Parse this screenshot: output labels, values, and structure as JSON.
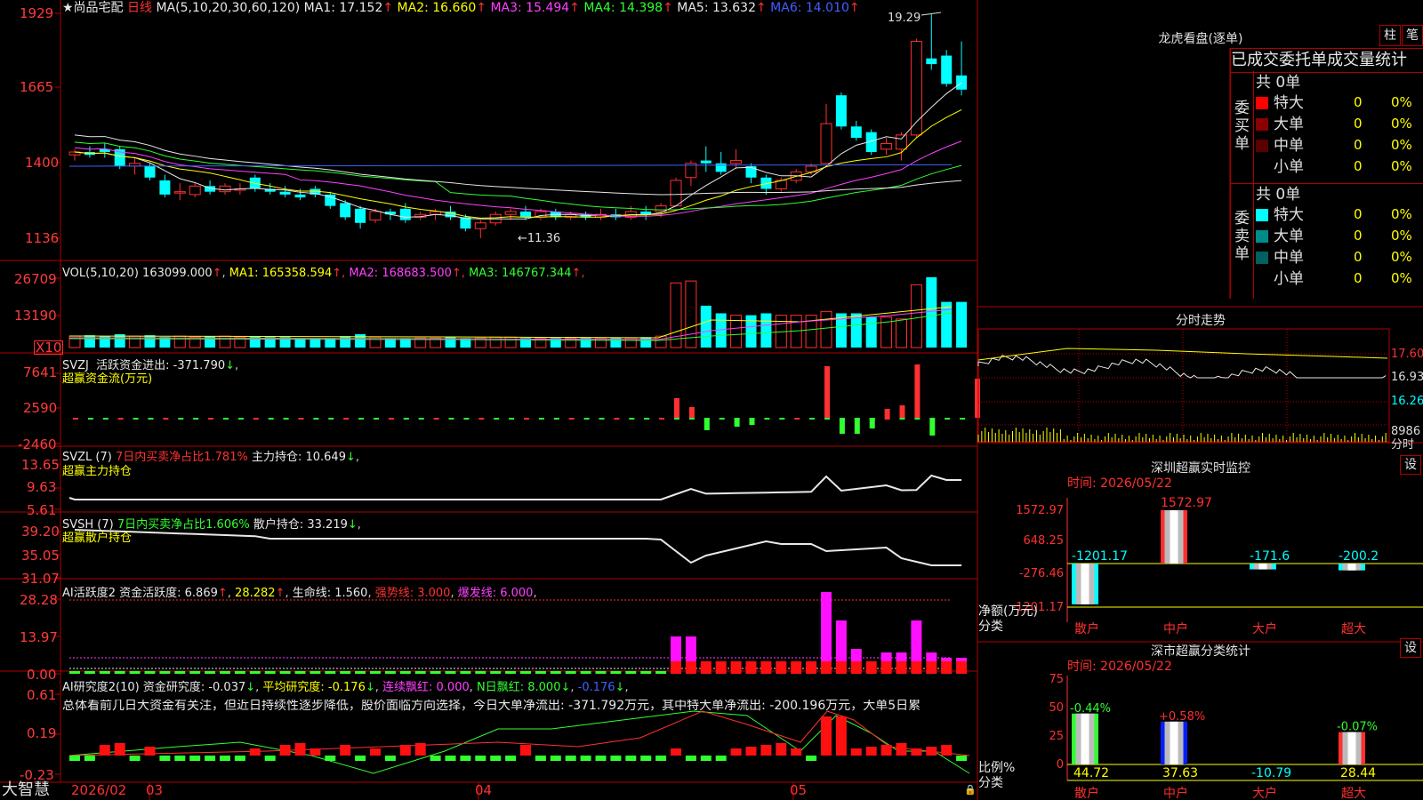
{
  "app": {
    "logo": "大智慧",
    "stock_name": "★尚品宅配",
    "period": "日线"
  },
  "colors": {
    "up": "#ff3030",
    "down": "#00ffff",
    "grid": "#b00000",
    "text_red": "#ff3b3b"
  },
  "main_chart": {
    "ma_params": "MA(5,10,20,30,60,120)",
    "ma_values": [
      {
        "label": "MA1: 17.152",
        "color": "#e8e8e8"
      },
      {
        "label": "MA2: 16.660",
        "color": "#ffff00"
      },
      {
        "label": "MA3: 15.494",
        "color": "#ff40ff"
      },
      {
        "label": "MA4: 14.398",
        "color": "#30ff30"
      },
      {
        "label": "MA5: 13.632",
        "color": "#e8e8e8"
      },
      {
        "label": "MA6: 14.010",
        "color": "#4060ff"
      }
    ],
    "y_ticks": [
      "1929",
      "1665",
      "1400",
      "1136"
    ],
    "high_label": "19.29",
    "low_label": "←11.36"
  },
  "volume_panel": {
    "title": "VOL(5,10,20)",
    "value": "163099.000",
    "mas": [
      {
        "label": "MA1: 165358.594",
        "color": "#ffff00"
      },
      {
        "label": "MA2: 168683.500",
        "color": "#ff40ff"
      },
      {
        "label": "MA3: 146767.344",
        "color": "#30ff30"
      }
    ],
    "y_ticks": [
      "26709",
      "13190"
    ],
    "unit": "X10"
  },
  "svzj_panel": {
    "title": "SVZJ",
    "label": "活跃资金进出: -371.790",
    "subtitle": "超赢资金流(万元)",
    "y_ticks": [
      "7641",
      "2590",
      "-2460"
    ]
  },
  "svzl_panel": {
    "title": "SVZL (7)",
    "ratio": "7日内买卖净占比1.781%",
    "label": "主力持仓: 10.649",
    "subtitle": "超赢主力持仓",
    "y_ticks": [
      "13.65",
      "9.63",
      "5.61"
    ]
  },
  "svsh_panel": {
    "title": "SVSH (7)",
    "ratio": "7日内买卖净占比1.606%",
    "label": "散户持仓: 33.219",
    "subtitle": "超赢散户持仓",
    "y_ticks": [
      "39.20",
      "35.05",
      "31.07"
    ]
  },
  "ai_active_panel": {
    "title": "AI活跃度2",
    "label": "资金活跃度: 6.869",
    "v2": "28.282",
    "life": "生命线: 1.560",
    "strong": "强势线: 3.000",
    "burst": "爆发线: 6.000",
    "y_ticks": [
      "28.28",
      "13.97",
      "0.00"
    ]
  },
  "ai_research_panel": {
    "title": "AI研究度2(10)",
    "label": "资金研究度: -0.037",
    "avg": "平均研究度: -0.176",
    "cont": "连续飘红: 0.000",
    "nday": "N日飘红: 8.000",
    "last": "-0.176",
    "comment": "总体看前几日大资金有关注，但近日持续性逐步降低，股价面临方向选择，今日大单净流出: -371.792万元，其中特大单净流出: -200.196万元，大单5日累",
    "y_ticks": [
      "0.61",
      "0.19",
      "-0.23"
    ]
  },
  "x_axis": {
    "labels": [
      "2026/02",
      "03",
      "04",
      "05"
    ]
  },
  "dragon_tiger": {
    "title": "龙虎看盘(逐单)",
    "btn_bar": "柱",
    "btn_pen": "笔",
    "tabs": [
      "已成交",
      "委托单",
      "成交量统计"
    ],
    "buy_group": {
      "side": "委买单",
      "total": "共 0单",
      "rows": [
        {
          "name": "特大",
          "count": "0",
          "pct": "0%",
          "color": "#ff0000"
        },
        {
          "name": "大单",
          "count": "0",
          "pct": "0%",
          "color": "#8b0000"
        },
        {
          "name": "中单",
          "count": "0",
          "pct": "0%",
          "color": "#5a0000"
        },
        {
          "name": "小单",
          "count": "0",
          "pct": "0%",
          "color": "#000000"
        }
      ]
    },
    "sell_group": {
      "side": "委卖单",
      "total": "共 0单",
      "rows": [
        {
          "name": "特大",
          "count": "0",
          "pct": "0%",
          "color": "#00ffff"
        },
        {
          "name": "大单",
          "count": "0",
          "pct": "0%",
          "color": "#008b8b"
        },
        {
          "name": "中单",
          "count": "0",
          "pct": "0%",
          "color": "#006060"
        },
        {
          "name": "小单",
          "count": "0",
          "pct": "0%",
          "color": "#000000"
        }
      ]
    }
  },
  "intraday": {
    "title": "分时走势",
    "prices": [
      "17.60",
      "16.93",
      "16.26"
    ],
    "volume": "8986",
    "vol_label": "分时"
  },
  "sz_monitor": {
    "title": "深圳超赢实时监控",
    "settings": "设",
    "time": "时间: 2026/05/22",
    "y_ticks": [
      "1572.97",
      "648.25",
      "-276.46",
      "-1201.17"
    ],
    "y_label": "净额(万元)",
    "x_label": "分类",
    "categories": [
      "散户",
      "中户",
      "大户",
      "超大"
    ],
    "values": [
      -1201.17,
      1572.97,
      -171.6,
      -200.2
    ],
    "value_labels": [
      "-1201.17",
      "1572.97",
      "-171.6",
      "-200.2"
    ]
  },
  "sz_category": {
    "title": "深市超赢分类统计",
    "settings": "设",
    "time": "时间: 2026/05/22",
    "y_ticks": [
      "75",
      "50",
      "25",
      "0"
    ],
    "y_label": "比例%",
    "x_label": "分类",
    "categories": [
      "散户",
      "中户",
      "大户",
      "超大"
    ],
    "values": [
      44.72,
      37.63,
      -10.79,
      28.44
    ],
    "value_labels": [
      "44.72",
      "37.63",
      "-10.79",
      "28.44"
    ],
    "change_labels": [
      "-0.44%",
      "+0.58%",
      "",
      "-0.07%"
    ]
  }
}
